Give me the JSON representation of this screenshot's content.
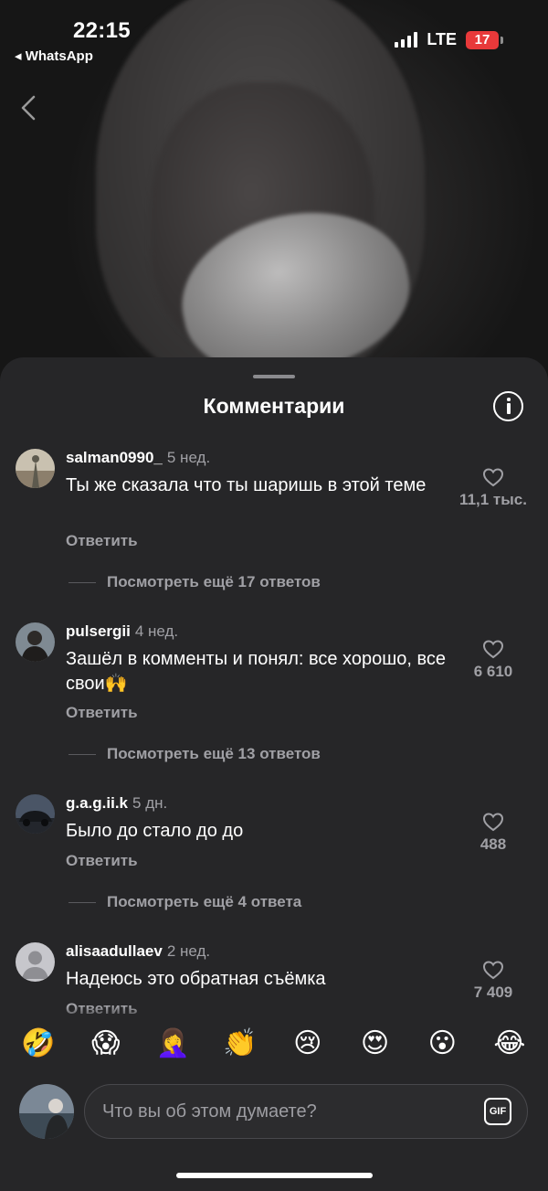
{
  "status_bar": {
    "time": "22:15",
    "back_app": "◂ WhatsApp",
    "network": "LTE",
    "battery": "17"
  },
  "sheet": {
    "title": "Комментарии"
  },
  "comments": [
    {
      "username": "salman0990_",
      "time": "5 нед.",
      "text": "Ты же сказала что ты шаришь в этой теме",
      "reply_label": "Ответить",
      "likes": "11,1 тыс.",
      "more_replies": "Посмотреть ещё 17 ответов"
    },
    {
      "username": "pulsergii",
      "time": "4 нед.",
      "text": "Зашёл в комменты и понял: все хорошо, все свои🙌",
      "reply_label": "Ответить",
      "likes": "6 610",
      "more_replies": "Посмотреть ещё 13 ответов"
    },
    {
      "username": "g.a.g.ii.k",
      "time": "5 дн.",
      "text": "Было до стало до до",
      "reply_label": "Ответить",
      "likes": "488",
      "more_replies": "Посмотреть ещё 4 ответа"
    },
    {
      "username": "alisaadullaev",
      "time": "2 нед.",
      "text": "Надеюсь это обратная съёмка",
      "reply_label": "Ответить",
      "likes": "7 409"
    }
  ],
  "emoji_bar": [
    "🤣",
    "😱",
    "🤦‍♀️",
    "👏",
    "😢",
    "😍",
    "😮",
    "😂"
  ],
  "input": {
    "placeholder": "Что вы об этом думаете?",
    "gif_label": "GIF"
  }
}
